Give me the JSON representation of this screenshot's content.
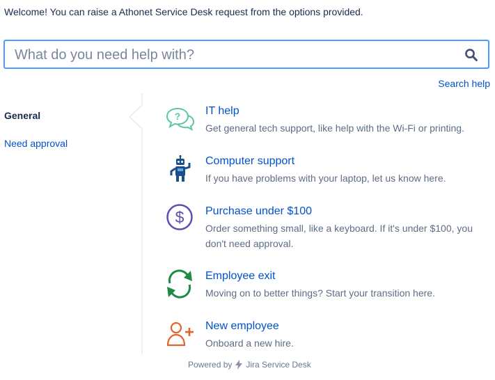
{
  "welcome_text": "Welcome! You can raise a Athonet Service Desk request from the options provided.",
  "search": {
    "placeholder": "What do you need help with?",
    "value": "",
    "help_link": "Search help"
  },
  "sidebar": {
    "items": [
      {
        "label": "General",
        "active": true
      },
      {
        "label": "Need approval",
        "active": false
      }
    ]
  },
  "requests": [
    {
      "title": "IT help",
      "description": "Get general tech support, like help with the Wi-Fi or printing.",
      "icon": "chat-bubbles-icon",
      "color": "#5cc5a9"
    },
    {
      "title": "Computer support",
      "description": "If you have problems with your laptop, let us know here.",
      "icon": "robot-icon",
      "color": "#1a4f8b"
    },
    {
      "title": "Purchase under $100",
      "description": "Order something small, like a keyboard. If it's under $100, you don't need approval.",
      "icon": "dollar-icon",
      "color": "#5e4db2"
    },
    {
      "title": "Employee exit",
      "description": "Moving on to better things? Start your transition here.",
      "icon": "cycle-arrows-icon",
      "color": "#1f8a44"
    },
    {
      "title": "New employee",
      "description": "Onboard a new hire.",
      "icon": "add-user-icon",
      "color": "#e5622b"
    }
  ],
  "footer": {
    "prefix": "Powered by",
    "brand": "Jira Service Desk"
  },
  "colors": {
    "link": "#0052cc",
    "focus_border": "#4c9aff",
    "muted_text": "#5e6c84"
  }
}
